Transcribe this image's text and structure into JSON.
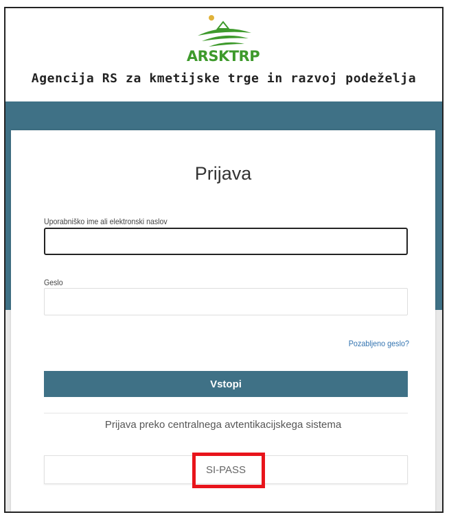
{
  "header": {
    "logo_text": "ARSKTRP",
    "agency_name": "Agencija RS za kmetijske trge in razvoj podeželja",
    "logo_icon": "sun-hills-logo-icon"
  },
  "login": {
    "title": "Prijava",
    "username_label": "Uporabniško ime ali elektronski naslov",
    "username_value": "",
    "password_label": "Geslo",
    "password_value": "",
    "forgot_link": "Pozabljeno geslo?",
    "submit_label": "Vstopi",
    "central_auth_text": "Prijava preko centralnega avtentikacijskega sistema",
    "sipass_label": "SI-PASS"
  },
  "colors": {
    "brand_green": "#3e9a2c",
    "band_blue": "#3f7186",
    "link_blue": "#3273b0",
    "highlight_red": "#e8141b"
  }
}
